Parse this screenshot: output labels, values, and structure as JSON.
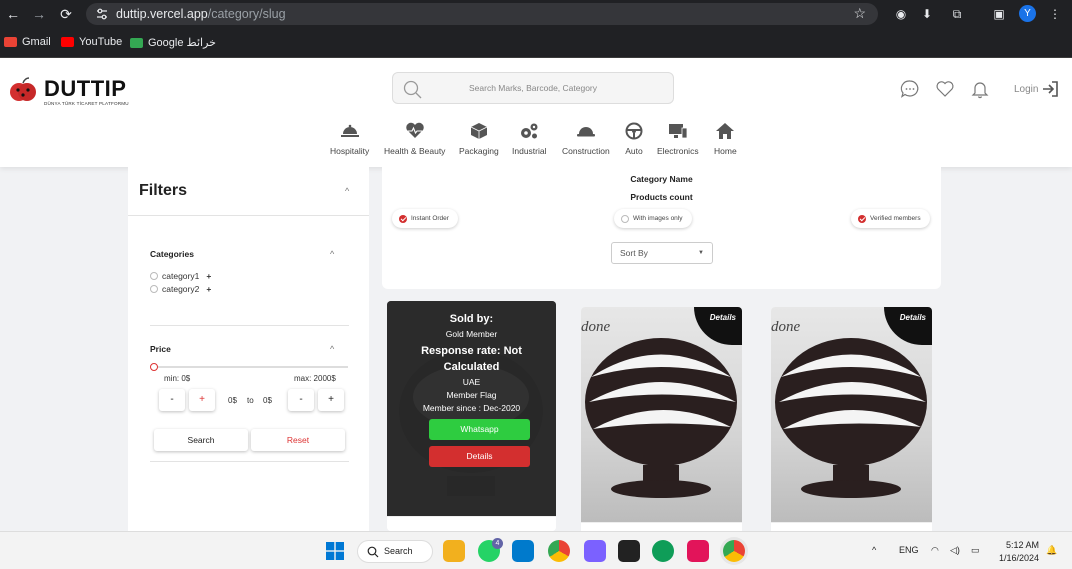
{
  "browser": {
    "url_host": "duttip.vercel.app",
    "url_path": "/category/slug",
    "profile_initial": "Y",
    "bookmarks": [
      {
        "label": "Gmail",
        "color": "#ea4335"
      },
      {
        "label": "YouTube",
        "color": "#ff0000"
      },
      {
        "label": "Google خرائط",
        "color": "#34a853"
      }
    ]
  },
  "site": {
    "logo": "DUTTIP",
    "logo_sub": "DÜNYA TÜRK TİCARET PLATFORMU",
    "search_placeholder": "Search Marks, Barcode, Category",
    "login": "Login",
    "categories": [
      {
        "label": "Hospitality",
        "icon": "hospitality-icon"
      },
      {
        "label": "Health & Beauty",
        "icon": "heartbeat-icon"
      },
      {
        "label": "Packaging",
        "icon": "box-icon"
      },
      {
        "label": "Industrial",
        "icon": "gears-icon"
      },
      {
        "label": "Construction",
        "icon": "hardhat-icon"
      },
      {
        "label": "Auto",
        "icon": "steering-wheel-icon"
      },
      {
        "label": "Electronics",
        "icon": "computer-icon"
      },
      {
        "label": "Home",
        "icon": "home-icon"
      }
    ]
  },
  "filters": {
    "title": "Filters",
    "categories_title": "Categories",
    "category_items": [
      "category1",
      "category2"
    ],
    "price_title": "Price",
    "min_label": "min: 0$",
    "max_label": "max: 2000$",
    "from_value": "0$",
    "to_label": "to",
    "to_value": "0$",
    "minus": "-",
    "plus": "+",
    "search_btn": "Search",
    "reset_btn": "Reset"
  },
  "main": {
    "category_name": "Category Name",
    "products_count": "Products count",
    "chips": {
      "instant_order": "Instant Order",
      "with_images": "With images only",
      "verified": "Verified members"
    },
    "sort_by": "Sort By"
  },
  "cards": {
    "overlay": {
      "sold_by": "Sold by:",
      "member_level": "Gold Member",
      "response_rate": "Response rate: Not Calculated",
      "country": "UAE",
      "flag": "Member Flag",
      "since": "Member since : Dec-2020",
      "whatsapp": "Whatsapp",
      "details": "Details"
    },
    "done_label": "done",
    "details_tag": "Details"
  },
  "taskbar": {
    "search": "Search",
    "lang": "ENG",
    "time": "5:12 AM",
    "date": "1/16/2024",
    "whatsapp_badge": "4"
  }
}
